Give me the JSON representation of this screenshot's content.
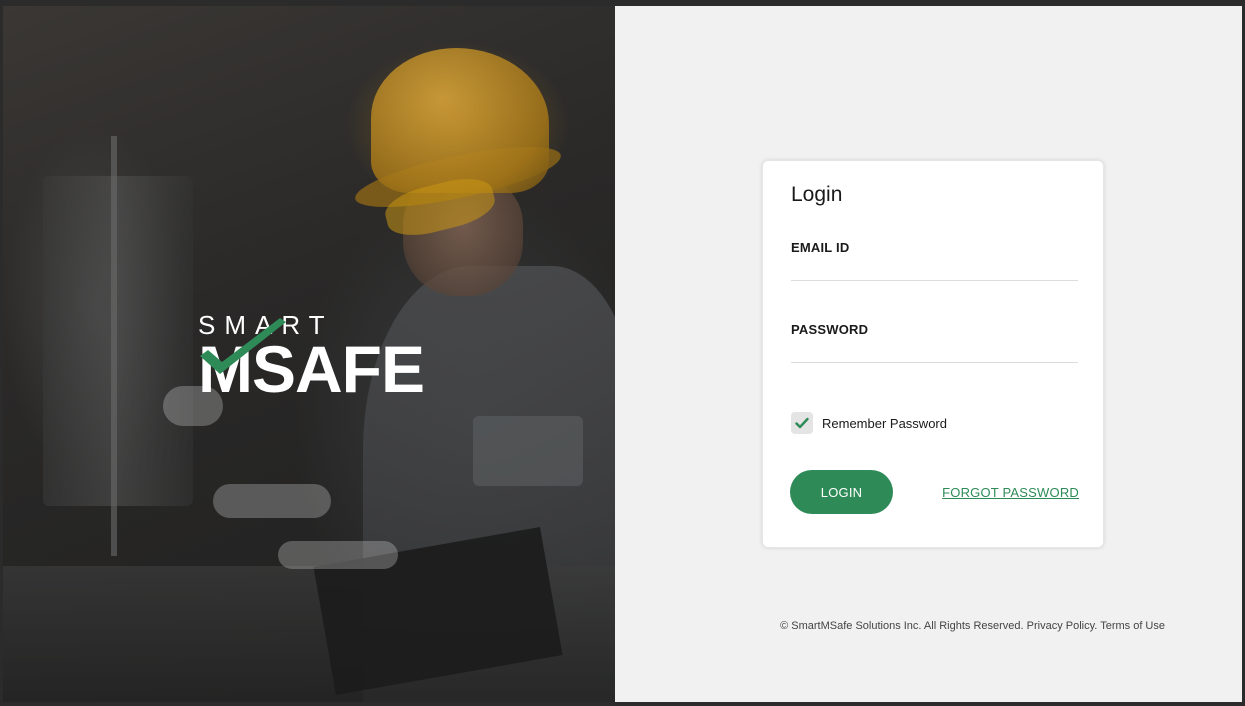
{
  "brand": {
    "word_top": "SMART",
    "word_bottom": "MSAFE",
    "check_color": "#2e8b57"
  },
  "login_card": {
    "title": "Login",
    "email_label": "EMAIL ID",
    "email_value": "",
    "password_label": "PASSWORD",
    "password_value": "",
    "remember_label": "Remember Password",
    "remember_checked": true,
    "login_button": "LOGIN",
    "forgot_link": "FORGOT PASSWORD"
  },
  "footer": {
    "copyright": "© SmartMSafe Solutions Inc. All Rights Reserved.",
    "privacy": "Privacy Policy.",
    "terms": "Terms of Use"
  },
  "colors": {
    "accent": "#2e8b57",
    "panel_bg": "#f1f1f1",
    "card_bg": "#ffffff"
  },
  "icons": {
    "checkbox": "check-icon",
    "logo_mark": "checkmark-logo-icon"
  }
}
